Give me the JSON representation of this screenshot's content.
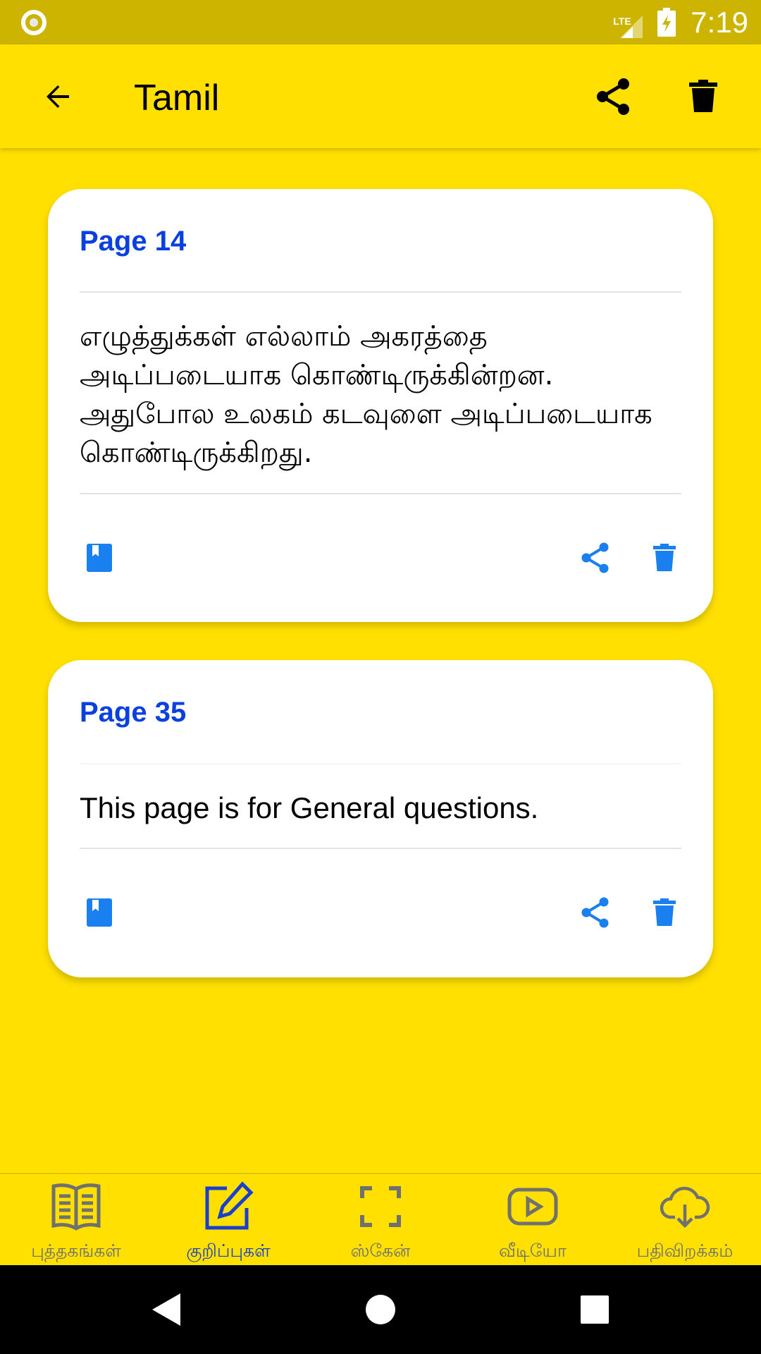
{
  "status_bar": {
    "time": "7:19",
    "network": "LTE"
  },
  "app_bar": {
    "title": "Tamil"
  },
  "notes": [
    {
      "page": "Page 14",
      "text": "எழுத்துக்கள் எல்லாம் அகரத்தை அடிப்படையாக கொண்டிருக்கின்றன. அதுபோல உலகம் கடவுளை அடிப்படையாக கொண்டிருக்கிறது."
    },
    {
      "page": "Page 35",
      "text": "This page is for General questions."
    }
  ],
  "bottom_nav": [
    {
      "label": "புத்தகங்கள்",
      "icon": "book-open-icon",
      "active": false
    },
    {
      "label": "குறிப்புகள்",
      "icon": "edit-note-icon",
      "active": true
    },
    {
      "label": "ஸ்கேன்",
      "icon": "scan-icon",
      "active": false
    },
    {
      "label": "வீடியோ",
      "icon": "video-play-icon",
      "active": false
    },
    {
      "label": "பதிவிறக்கம்",
      "icon": "cloud-download-icon",
      "active": false
    }
  ],
  "colors": {
    "accent": "#FFE000",
    "status_bar": "#CCB400",
    "link_blue": "#0A40E0",
    "icon_blue": "#1A7FEF"
  }
}
